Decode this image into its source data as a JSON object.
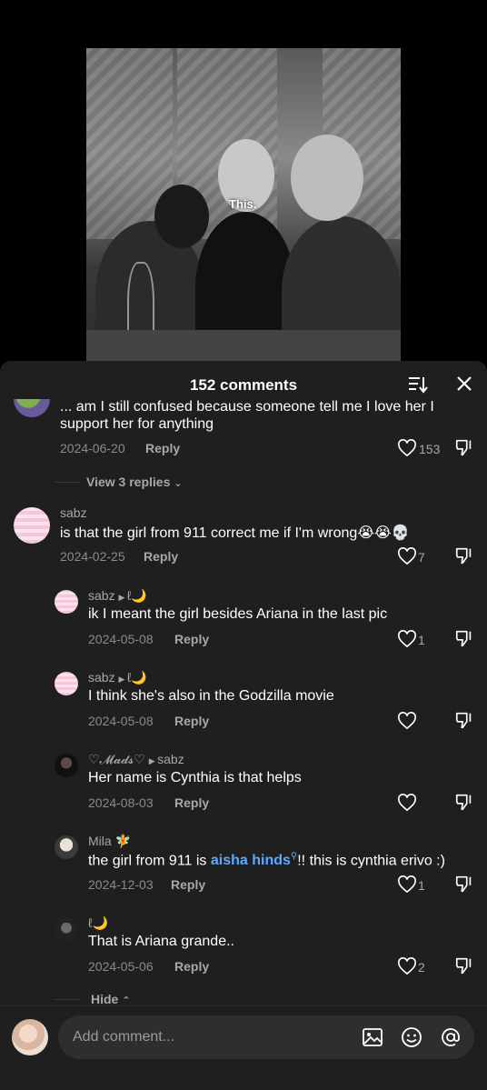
{
  "video": {
    "caption": "This."
  },
  "sheet": {
    "title": "152 comments"
  },
  "comments": [
    {
      "text_line1": "... am I still confused because someone tell me I love her I",
      "text_line2": "support her for anything",
      "date": "2024-06-20",
      "reply_label": "Reply",
      "likes": "153"
    },
    {
      "view_replies": "View 3 replies"
    },
    {
      "username": "sabz",
      "text": "is that the girl from 911 correct me if I'm wrong😭😭💀",
      "date": "2024-02-25",
      "reply_label": "Reply",
      "likes": "7"
    },
    {
      "username": "sabz",
      "reply_to": "ℓ🌙",
      "text": "ik I meant the girl besides Ariana in the last pic",
      "date": "2024-05-08",
      "reply_label": "Reply",
      "likes": "1"
    },
    {
      "username": "sabz",
      "reply_to": "ℓ🌙",
      "text": "I think she's also in the Godzilla movie",
      "date": "2024-05-08",
      "reply_label": "Reply",
      "likes": ""
    },
    {
      "username": "♡𝓜𝓪𝓭𝓼♡",
      "reply_to": "sabz",
      "text": "Her name is Cynthia is that helps",
      "date": "2024-08-03",
      "reply_label": "Reply",
      "likes": ""
    },
    {
      "username": "Mila 🧚",
      "text_before": "the girl from 911 is ",
      "link_text": "aisha hinds",
      "text_after": "!! this is cynthia erivo :)",
      "date": "2024-12-03",
      "reply_label": "Reply",
      "likes": "1"
    },
    {
      "username": "ℓ🌙",
      "text": "That is Ariana grande..",
      "date": "2024-05-06",
      "reply_label": "Reply",
      "likes": "2"
    },
    {
      "hide_label": "Hide"
    }
  ],
  "composer": {
    "placeholder": "Add comment..."
  },
  "icons": {
    "sort": "sort-icon",
    "close": "close-icon",
    "heart": "heart-icon",
    "dislike": "dislike-icon",
    "image": "image-icon",
    "emoji": "emoji-icon",
    "mention": "at-mention-icon"
  },
  "colors": {
    "background": "#1f1f1f",
    "link": "#5fa9ff",
    "muted": "#8a8a8a"
  }
}
